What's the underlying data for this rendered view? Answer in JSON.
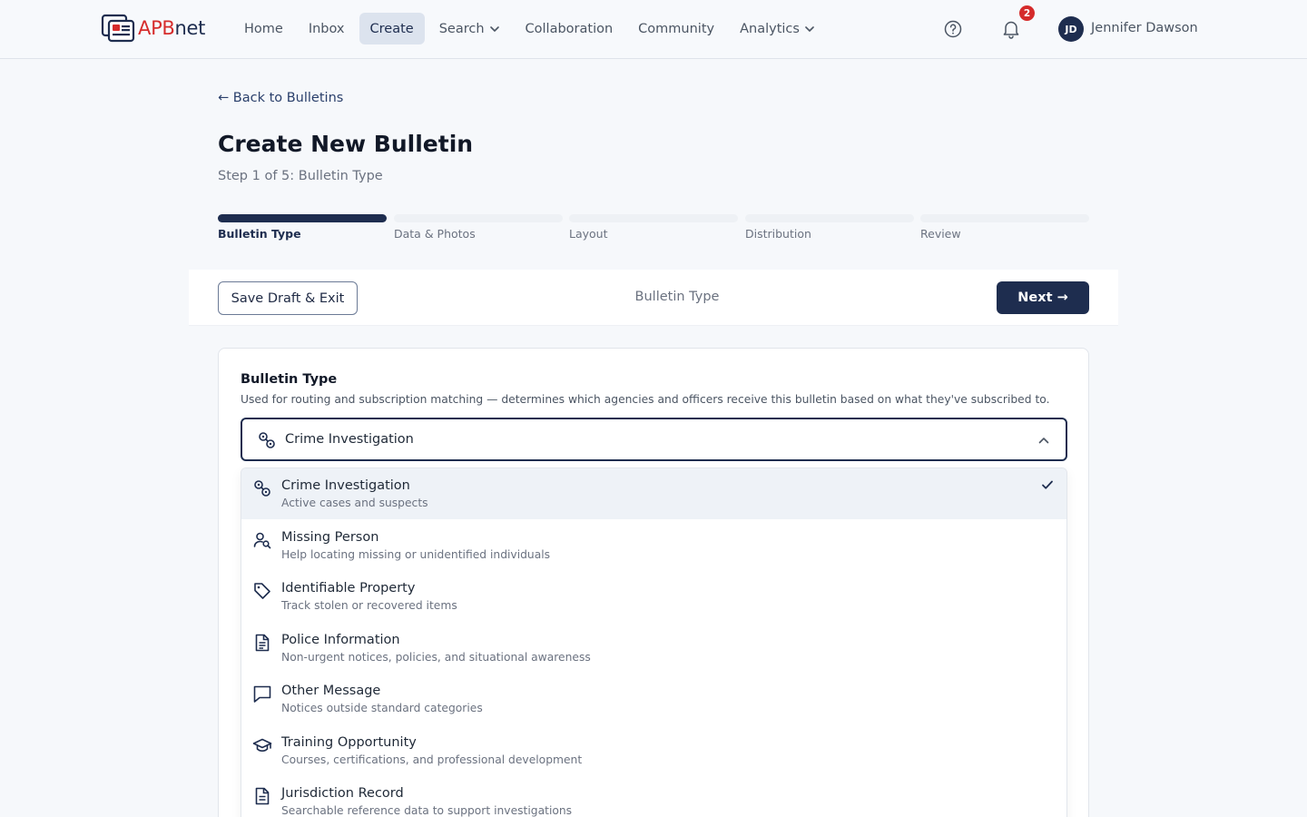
{
  "nav": {
    "logo": {
      "apb": "APB",
      "net": "net"
    },
    "items": [
      {
        "label": "Home"
      },
      {
        "label": "Inbox"
      },
      {
        "label": "Create"
      },
      {
        "label": "Search"
      },
      {
        "label": "Collaboration"
      },
      {
        "label": "Community"
      },
      {
        "label": "Analytics"
      }
    ],
    "active_item": "Create",
    "notification_count": "2",
    "user": {
      "initials": "JD",
      "name": "Jennifer Dawson"
    }
  },
  "page": {
    "back_link": "← Back to Bulletins",
    "title": "Create New Bulletin",
    "step_text": "Step 1 of 5: Bulletin Type"
  },
  "stepper": {
    "steps": [
      {
        "label": "Bulletin Type",
        "active": true
      },
      {
        "label": "Data & Photos",
        "active": false
      },
      {
        "label": "Layout",
        "active": false
      },
      {
        "label": "Distribution",
        "active": false
      },
      {
        "label": "Review",
        "active": false
      }
    ]
  },
  "action_bar": {
    "save_draft": "Save Draft & Exit",
    "current_step": "Bulletin Type",
    "next": "Next →"
  },
  "form": {
    "label": "Bulletin Type",
    "help": "Used for routing and subscription matching — determines which agencies and officers receive this bulletin based on what they've subscribed to.",
    "selected_value": "Crime Investigation",
    "options": [
      {
        "icon": "handcuffs-icon",
        "title": "Crime Investigation",
        "desc": "Active cases and suspects",
        "selected": true
      },
      {
        "icon": "person-search-icon",
        "title": "Missing Person",
        "desc": "Help locating missing or unidentified individuals",
        "selected": false
      },
      {
        "icon": "tag-icon",
        "title": "Identifiable Property",
        "desc": "Track stolen or recovered items",
        "selected": false
      },
      {
        "icon": "document-icon",
        "title": "Police Information",
        "desc": "Non-urgent notices, policies, and situational awareness",
        "selected": false
      },
      {
        "icon": "message-icon",
        "title": "Other Message",
        "desc": "Notices outside standard categories",
        "selected": false
      },
      {
        "icon": "graduation-cap-icon",
        "title": "Training Opportunity",
        "desc": "Courses, certifications, and professional development",
        "selected": false
      },
      {
        "icon": "record-document-icon",
        "title": "Jurisdiction Record",
        "desc": "Searchable reference data to support investigations",
        "selected": false
      }
    ]
  },
  "colors": {
    "brand_navy": "#1e2d4f",
    "brand_red": "#d62c2c",
    "badge_red": "#d52b2b"
  }
}
